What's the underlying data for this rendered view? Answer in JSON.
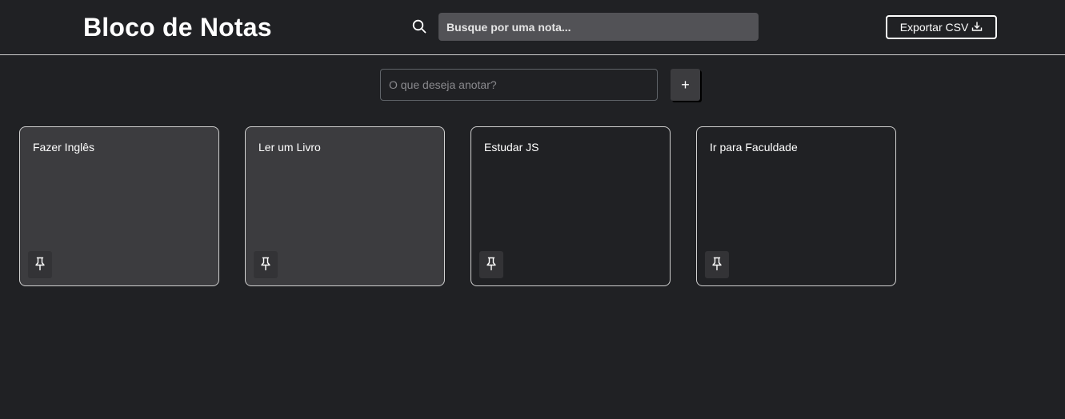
{
  "header": {
    "title": "Bloco de Notas",
    "search": {
      "placeholder": "Busque por uma nota...",
      "value": ""
    },
    "export_label": "Exportar CSV"
  },
  "composer": {
    "placeholder": "O que deseja anotar?",
    "value": "",
    "add_label": "+"
  },
  "notes": [
    {
      "text": "Fazer Inglês",
      "pinned": true
    },
    {
      "text": "Ler um Livro",
      "pinned": true
    },
    {
      "text": "Estudar JS",
      "pinned": false
    },
    {
      "text": "Ir para Faculdade",
      "pinned": false
    }
  ],
  "colors": {
    "background": "#202124",
    "pinned_card": "#3c3c3f",
    "search_field": "#525256",
    "border": "#d0d0d0"
  },
  "icons": {
    "search": "search-icon",
    "export": "download-icon",
    "pin": "pin-icon"
  }
}
